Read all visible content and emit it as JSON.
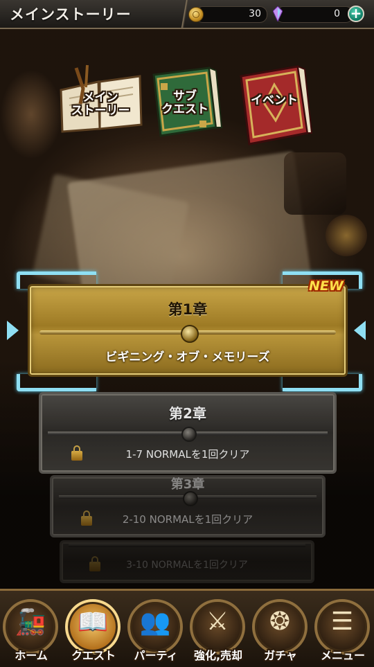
{
  "header": {
    "title": "メインストーリー",
    "coins": "30",
    "gems": "0",
    "add_symbol": "+"
  },
  "categories": [
    {
      "label_line1": "メイン",
      "label_line2": "ストーリー",
      "icon": "open-book-icon",
      "color": "#d9c9a4"
    },
    {
      "label_line1": "サブ",
      "label_line2": "クエスト",
      "icon": "green-book-icon",
      "color": "#2f6a3a"
    },
    {
      "label_line1": "イベント",
      "label_line2": "",
      "icon": "red-book-icon",
      "color": "#a42a2a"
    }
  ],
  "chapters": [
    {
      "title": "第1章",
      "subtitle": "ビギニング・オブ・メモリーズ",
      "state": "selected",
      "badge": "NEW"
    },
    {
      "title": "第2章",
      "requirement": "1-7 NORMALを1回クリア",
      "state": "locked"
    },
    {
      "title": "第3章",
      "requirement": "2-10 NORMALを1回クリア",
      "state": "locked"
    },
    {
      "title": "",
      "requirement": "3-10 NORMALを1回クリア",
      "state": "locked"
    }
  ],
  "nav": [
    {
      "label": "ホーム",
      "icon": "train-icon",
      "glyph": "🚂",
      "active": false
    },
    {
      "label": "クエスト",
      "icon": "book-icon",
      "glyph": "📖",
      "active": true
    },
    {
      "label": "パーティ",
      "icon": "party-icon",
      "glyph": "👥",
      "active": false
    },
    {
      "label": "強化,売却",
      "icon": "swords-icon",
      "glyph": "⚔",
      "active": false
    },
    {
      "label": "ガチャ",
      "icon": "scroll-icon",
      "glyph": "❂",
      "active": false
    },
    {
      "label": "メニュー",
      "icon": "menu-icon",
      "glyph": "☰",
      "active": false
    }
  ],
  "colors": {
    "accent_frame": "#8fdff3",
    "gold": "#c9a648",
    "new_badge": "#ffe04a"
  }
}
